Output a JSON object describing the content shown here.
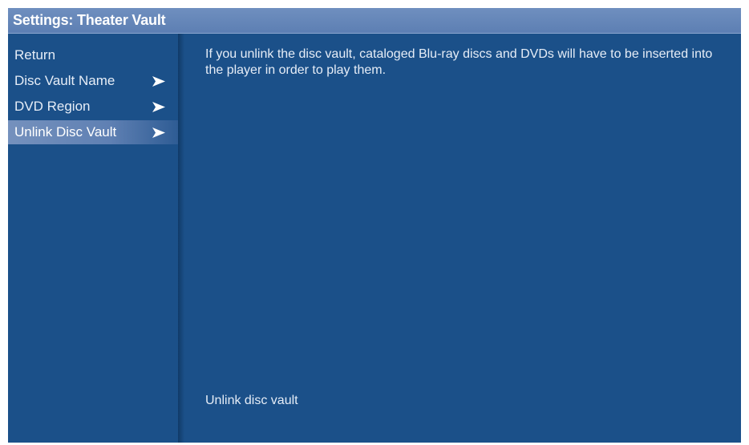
{
  "window": {
    "title": "Settings: Theater Vault"
  },
  "sidebar": {
    "items": [
      {
        "label": "Return",
        "has_arrow": false,
        "selected": false
      },
      {
        "label": "Disc Vault Name",
        "has_arrow": true,
        "selected": false
      },
      {
        "label": "DVD Region",
        "has_arrow": true,
        "selected": false
      },
      {
        "label": "Unlink Disc Vault",
        "has_arrow": true,
        "selected": true
      }
    ],
    "arrow_icon": "chevron-right-icon"
  },
  "content": {
    "description": "If you unlink the disc vault, cataloged Blu-ray discs and DVDs will have to be inserted into the player in order to play them.",
    "footer_hint": "Unlink disc vault"
  },
  "colors": {
    "background": "#1b5089",
    "titlebar": "#6485b7",
    "selected_item": "#7591bd",
    "text": "#e6edf7"
  }
}
